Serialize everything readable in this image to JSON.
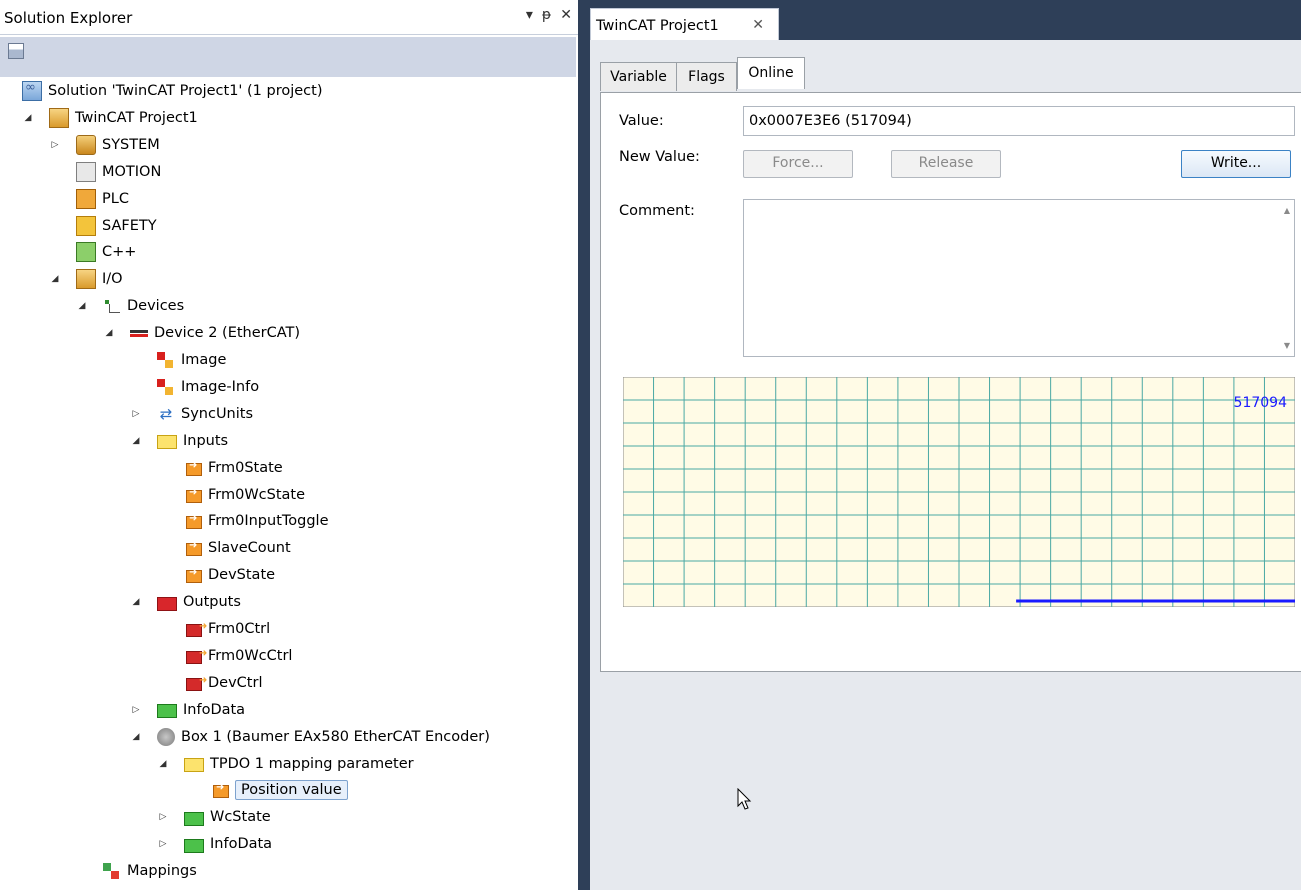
{
  "solution_explorer": {
    "title": "Solution Explorer",
    "title_buttons": [
      "▾",
      "ᵽ",
      "✕"
    ],
    "tree": [
      {
        "label": "Solution 'TwinCAT Project1' (1 project)",
        "icon": "solution-icon",
        "depth": 0,
        "expander": "none"
      },
      {
        "label": "TwinCAT Project1",
        "icon": "twincat-project-icon",
        "depth": 1,
        "expander": "expanded"
      },
      {
        "label": "SYSTEM",
        "icon": "system-icon",
        "depth": 2,
        "expander": "collapsed"
      },
      {
        "label": "MOTION",
        "icon": "motion-icon",
        "depth": 2,
        "expander": "none"
      },
      {
        "label": "PLC",
        "icon": "plc-icon",
        "depth": 2,
        "expander": "none"
      },
      {
        "label": "SAFETY",
        "icon": "safety-icon",
        "depth": 2,
        "expander": "none"
      },
      {
        "label": "C++",
        "icon": "cpp-icon",
        "depth": 2,
        "expander": "none"
      },
      {
        "label": "I/O",
        "icon": "io-icon",
        "depth": 2,
        "expander": "expanded"
      },
      {
        "label": "Devices",
        "icon": "devices-icon",
        "depth": 3,
        "expander": "expanded"
      },
      {
        "label": "Device 2 (EtherCAT)",
        "icon": "ethercat-device-icon",
        "depth": 4,
        "expander": "expanded"
      },
      {
        "label": "Image",
        "icon": "image-icon",
        "depth": 5,
        "expander": "none"
      },
      {
        "label": "Image-Info",
        "icon": "image-info-icon",
        "depth": 5,
        "expander": "none"
      },
      {
        "label": "SyncUnits",
        "icon": "syncunits-icon",
        "depth": 5,
        "expander": "collapsed"
      },
      {
        "label": "Inputs",
        "icon": "inputs-folder-icon",
        "depth": 5,
        "expander": "expanded"
      },
      {
        "label": "Frm0State",
        "icon": "input-variable-icon",
        "depth": 6,
        "expander": "none"
      },
      {
        "label": "Frm0WcState",
        "icon": "input-variable-icon",
        "depth": 6,
        "expander": "none"
      },
      {
        "label": "Frm0InputToggle",
        "icon": "input-variable-icon",
        "depth": 6,
        "expander": "none"
      },
      {
        "label": "SlaveCount",
        "icon": "input-variable-icon",
        "depth": 6,
        "expander": "none"
      },
      {
        "label": "DevState",
        "icon": "input-variable-icon",
        "depth": 6,
        "expander": "none"
      },
      {
        "label": "Outputs",
        "icon": "outputs-folder-icon",
        "depth": 5,
        "expander": "expanded"
      },
      {
        "label": "Frm0Ctrl",
        "icon": "output-variable-icon",
        "depth": 6,
        "expander": "none"
      },
      {
        "label": "Frm0WcCtrl",
        "icon": "output-variable-icon",
        "depth": 6,
        "expander": "none"
      },
      {
        "label": "DevCtrl",
        "icon": "output-variable-icon",
        "depth": 6,
        "expander": "none"
      },
      {
        "label": "InfoData",
        "icon": "infodata-folder-icon",
        "depth": 5,
        "expander": "collapsed"
      },
      {
        "label": "Box 1 (Baumer EAx580 EtherCAT Encoder)",
        "icon": "encoder-box-icon",
        "depth": 5,
        "expander": "expanded"
      },
      {
        "label": "TPDO 1 mapping parameter",
        "icon": "inputs-folder-icon",
        "depth": 6,
        "expander": "expanded"
      },
      {
        "label": "Position value",
        "icon": "input-variable-icon",
        "depth": 7,
        "expander": "none",
        "selected": true
      },
      {
        "label": "WcState",
        "icon": "infodata-folder-icon",
        "depth": 6,
        "expander": "collapsed"
      },
      {
        "label": "InfoData",
        "icon": "infodata-folder-icon",
        "depth": 6,
        "expander": "collapsed"
      },
      {
        "label": "Mappings",
        "icon": "mappings-icon",
        "depth": 3,
        "expander": "none"
      }
    ]
  },
  "document": {
    "tab_title": "TwinCAT Project1",
    "tabs": [
      "Variable",
      "Flags",
      "Online"
    ],
    "active_tab": "Online",
    "value_label": "Value:",
    "value": "0x0007E3E6 (517094)",
    "new_value_label": "New Value:",
    "force_label": "Force...",
    "release_label": "Release",
    "write_label": "Write...",
    "comment_label": "Comment:",
    "comment": ""
  },
  "chart_data": {
    "type": "line",
    "value_label": "517094",
    "grid": true,
    "colors": {
      "background": "#fffbe6",
      "grid": "#4aa8a4",
      "line": "#1a1aff",
      "label": "#1a1aff"
    },
    "series": [
      {
        "values_fraction_of_width_start": 0.585,
        "level": 0
      }
    ]
  }
}
